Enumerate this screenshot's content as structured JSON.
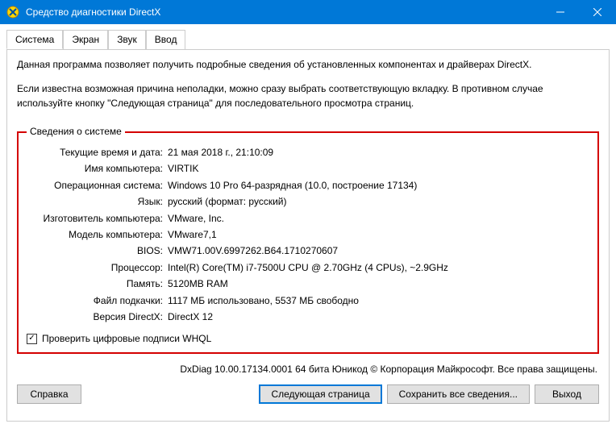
{
  "titlebar": {
    "title": "Средство диагностики DirectX"
  },
  "tabs": {
    "system": "Система",
    "screen": "Экран",
    "sound": "Звук",
    "input": "Ввод"
  },
  "intro": {
    "p1": "Данная программа позволяет получить подробные сведения об установленных компонентах и драйверах DirectX.",
    "p2": "Если известна возможная причина неполадки, можно сразу выбрать соответствующую вкладку. В противном случае используйте кнопку \"Следующая страница\" для последовательного просмотра страниц."
  },
  "group": {
    "title": "Сведения о системе",
    "rows": {
      "datetime": {
        "label": "Текущие время и дата:",
        "value": "21 мая 2018 г., 21:10:09"
      },
      "pcname": {
        "label": "Имя компьютера:",
        "value": "VIRTIK"
      },
      "os": {
        "label": "Операционная система:",
        "value": "Windows 10 Pro 64-разрядная (10.0, построение 17134)"
      },
      "lang": {
        "label": "Язык:",
        "value": "русский (формат: русский)"
      },
      "mfr": {
        "label": "Изготовитель компьютера:",
        "value": "VMware, Inc."
      },
      "model": {
        "label": "Модель компьютера:",
        "value": "VMware7,1"
      },
      "bios": {
        "label": "BIOS:",
        "value": "VMW71.00V.6997262.B64.1710270607"
      },
      "cpu": {
        "label": "Процессор:",
        "value": "Intel(R) Core(TM) i7-7500U CPU @ 2.70GHz (4 CPUs), ~2.9GHz"
      },
      "mem": {
        "label": "Память:",
        "value": "5120MB RAM"
      },
      "page": {
        "label": "Файл подкачки:",
        "value": "1117 МБ использовано, 5537 МБ свободно"
      },
      "dx": {
        "label": "Версия DirectX:",
        "value": "DirectX 12"
      }
    },
    "whql": "Проверить цифровые подписи WHQL"
  },
  "footer": "DxDiag 10.00.17134.0001 64 бита Юникод © Корпорация Майкрософт. Все права защищены.",
  "buttons": {
    "help": "Справка",
    "next": "Следующая страница",
    "saveall": "Сохранить все сведения...",
    "exit": "Выход"
  }
}
